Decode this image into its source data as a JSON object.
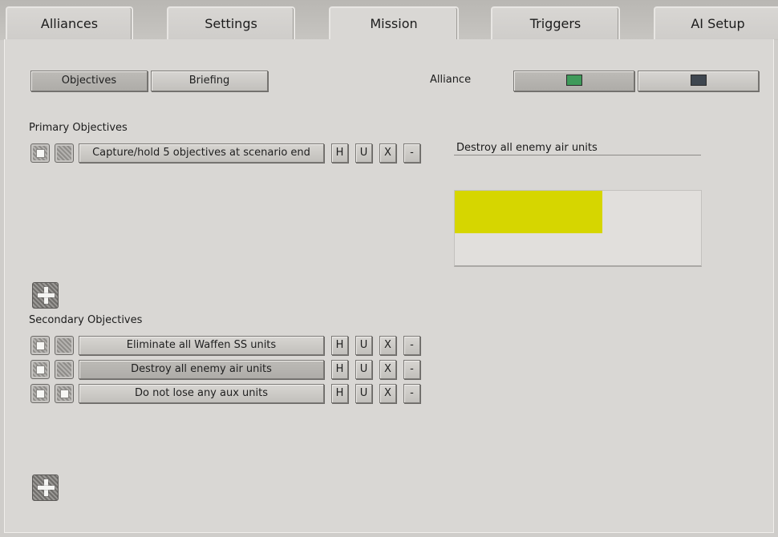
{
  "tabs": [
    {
      "label": "Alliances"
    },
    {
      "label": "Settings"
    },
    {
      "label": "Mission",
      "active": true
    },
    {
      "label": "Triggers"
    },
    {
      "label": "AI Setup"
    }
  ],
  "subtabs": {
    "objectives": "Objectives",
    "briefing": "Briefing"
  },
  "alliance": {
    "label": "Alliance",
    "options": [
      {
        "color": "#3f9a5a",
        "selected": true
      },
      {
        "color": "#3f4750",
        "selected": false
      }
    ]
  },
  "primary": {
    "heading": "Primary Objectives",
    "rows": [
      {
        "text": "Capture/hold 5 objectives at scenario end",
        "icon1": "checkbox",
        "icon2": "pattern"
      }
    ]
  },
  "secondary": {
    "heading": "Secondary Objectives",
    "rows": [
      {
        "text": "Eliminate all Waffen SS units",
        "icon1": "checkbox",
        "icon2": "pattern"
      },
      {
        "text": "Destroy all enemy air units",
        "icon1": "checkbox",
        "icon2": "pattern",
        "selected": true
      },
      {
        "text": "Do not lose any aux units",
        "icon1": "checkbox",
        "icon2": "checkbox"
      }
    ]
  },
  "row_buttons": {
    "h": "H",
    "u": "U",
    "x": "X",
    "minus": "-"
  },
  "detail": {
    "name": "Destroy all enemy air units",
    "color": "#d6d600",
    "progress": 0.6
  },
  "icons": {
    "add": "plus-icon",
    "check": "checkbox-icon",
    "pattern": "pattern-icon"
  }
}
